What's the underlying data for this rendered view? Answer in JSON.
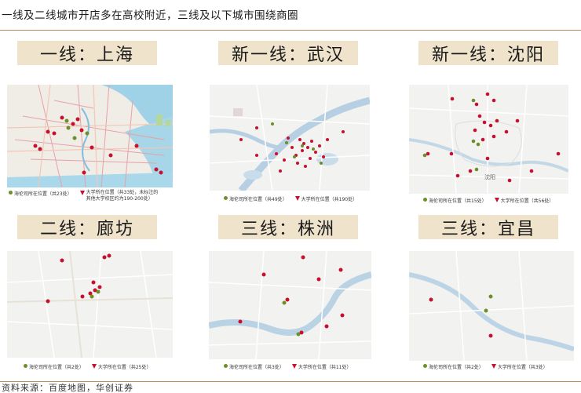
{
  "header": {
    "title": "一线及二线城市开店多在高校附近，三线及以下城市围绕商圈"
  },
  "panels": [
    {
      "label": "一线：上海",
      "legend": {
        "stores": "海伦司所在位置（共23处）",
        "universities": "大学所在位置（共33处，未标注的\n其他大学校区约为190-200处）"
      }
    },
    {
      "label": "新一线：武汉",
      "legend": {
        "stores": "海伦司所在位置（共49处）",
        "universities": "大学所在位置（共190处）"
      }
    },
    {
      "label": "新一线：沈阳",
      "legend": {
        "stores": "海伦司所在位置（共15处）",
        "universities": "大学所在位置（共56处）"
      }
    },
    {
      "label": "二线：廊坊",
      "legend": {
        "stores": "海伦司所在位置（共2处）",
        "universities": "大学所在位置（共25处）"
      }
    },
    {
      "label": "三线：株洲",
      "legend": {
        "stores": "海伦司所在位置（共3处）",
        "universities": "大学所在位置（共11处）"
      }
    },
    {
      "label": "三线：宜昌",
      "legend": {
        "stores": "海伦司所在位置（共2处）",
        "universities": "大学所在位置（共3处）"
      }
    }
  ],
  "map_texts": {
    "shenyang_district": "沈阳"
  },
  "colors": {
    "store_marker": "#6d8f2a",
    "university_marker": "#c8102e",
    "label_bg": "#efe3cc",
    "rule": "#b78a57"
  },
  "footer": {
    "source": "资料来源：百度地图，华创证券"
  }
}
